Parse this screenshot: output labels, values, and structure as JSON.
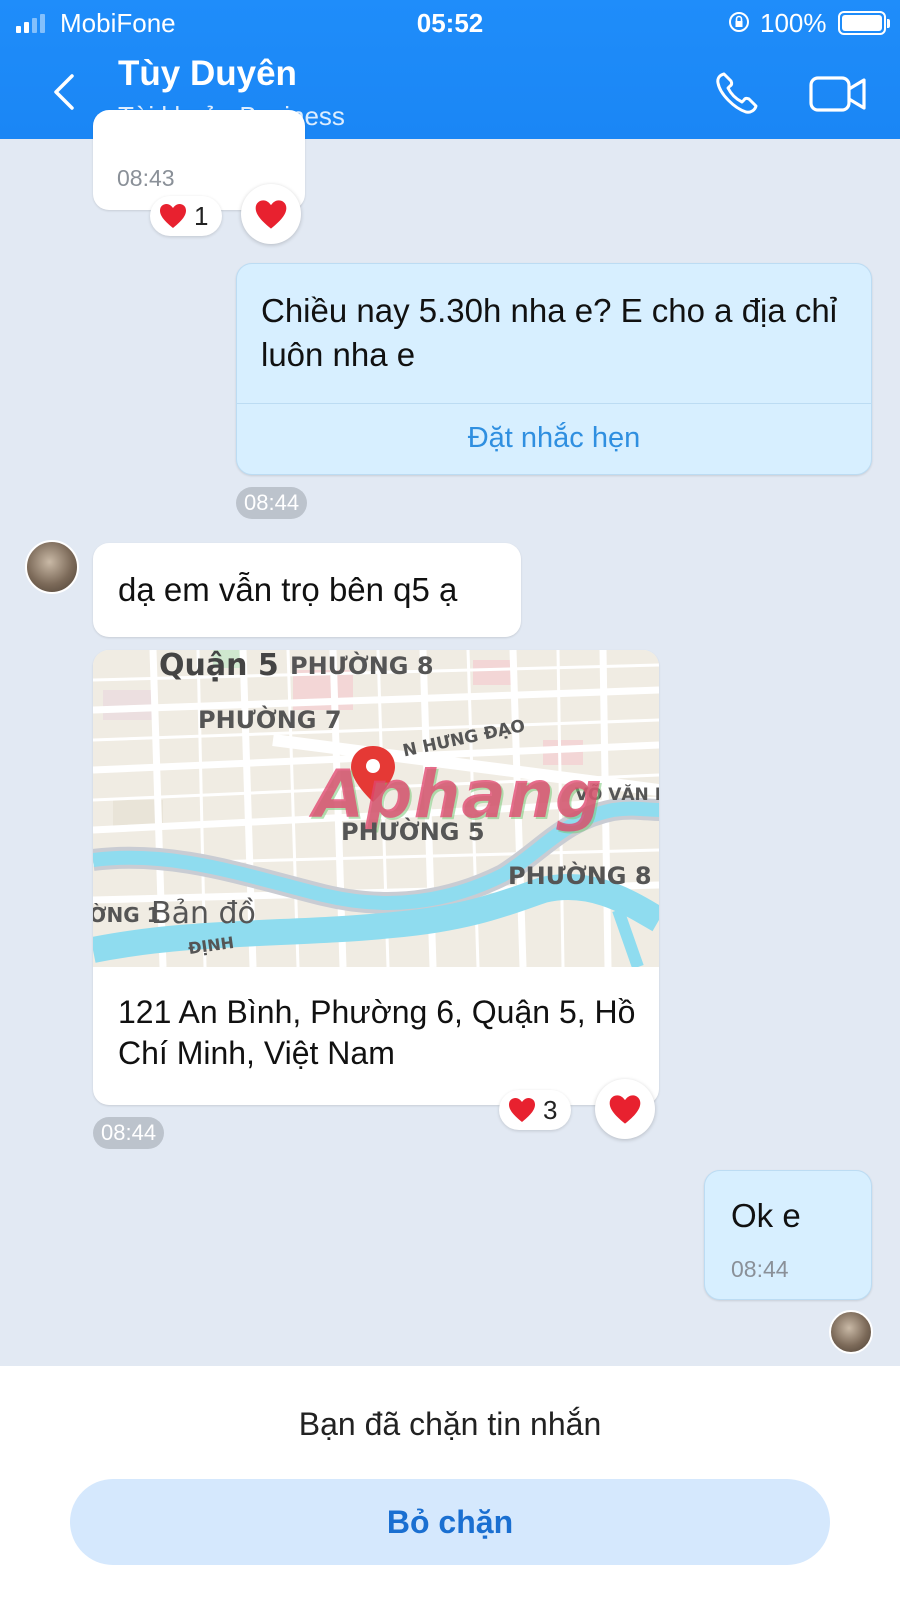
{
  "status_bar": {
    "carrier": "MobiFone",
    "time": "05:52",
    "battery": "100%"
  },
  "header": {
    "name": "Tùy Duyên",
    "subtitle": "Tài khoản Business"
  },
  "messages": {
    "m1": {
      "time": "08:43",
      "reaction_count": "1"
    },
    "m2": {
      "text": "Chiều nay 5.30h nha e? E cho a địa chỉ luôn nha e",
      "action": "Đặt nhắc hẹn",
      "time": "08:44"
    },
    "m3": {
      "text": "dạ em vẫn trọ bên q5 ạ"
    },
    "m4": {
      "map_labels": {
        "district": "Quận 5",
        "ward8_top": "PHƯỜNG 8",
        "ward7": "PHƯỜNG 7",
        "street1": "N HƯNG ĐẠO",
        "street2": "VÕ VĂN K",
        "ward5": "PHƯỜNG 5",
        "ward8_right": "PHƯỜNG 8",
        "ward_left": "ỜNG 1",
        "map_title": "Bản đồ",
        "bottom": "ĐỊNH",
        "watermark": "Aphang"
      },
      "address": "121 An Bình, Phường 6, Quận 5, Hồ Chí Minh, Việt Nam",
      "reaction_count": "3",
      "time": "08:44"
    },
    "m5": {
      "text": "Ok e",
      "time": "08:44"
    }
  },
  "footer": {
    "blocked_text": "Bạn đã chặn tin nhắn",
    "unblock_label": "Bỏ chặn"
  },
  "colors": {
    "header": "#1a86f5",
    "chat_bg": "#e2e9f3",
    "mine_bubble": "#d7efff",
    "link": "#1a6fd1",
    "heart": "#e8212f"
  }
}
